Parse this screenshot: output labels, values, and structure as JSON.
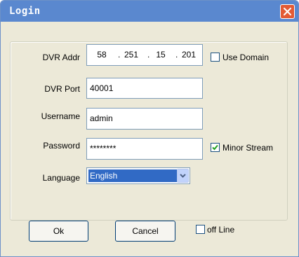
{
  "window": {
    "title": "Login"
  },
  "form": {
    "dvr_addr": {
      "label": "DVR Addr",
      "octets": [
        "58",
        "251",
        "15",
        "201"
      ]
    },
    "use_domain": {
      "label": "Use Domain",
      "checked": false
    },
    "dvr_port": {
      "label": "DVR Port",
      "value": "40001"
    },
    "username": {
      "label": "Username",
      "value": "admin"
    },
    "password": {
      "label": "Password",
      "value": "********"
    },
    "minor_stream": {
      "label": "Minor Stream",
      "checked": true
    },
    "language": {
      "label": "Language",
      "value": "English"
    }
  },
  "buttons": {
    "ok": "Ok",
    "cancel": "Cancel"
  },
  "offline": {
    "label": "off Line",
    "checked": false
  },
  "icons": {
    "close": "close-icon",
    "checkmark": "checkmark-icon",
    "dropdown": "chevron-down-icon"
  },
  "colors": {
    "titlebar": "#5a88cf",
    "close": "#e35b35",
    "selection": "#316ac5",
    "checkmark": "#21a121"
  }
}
